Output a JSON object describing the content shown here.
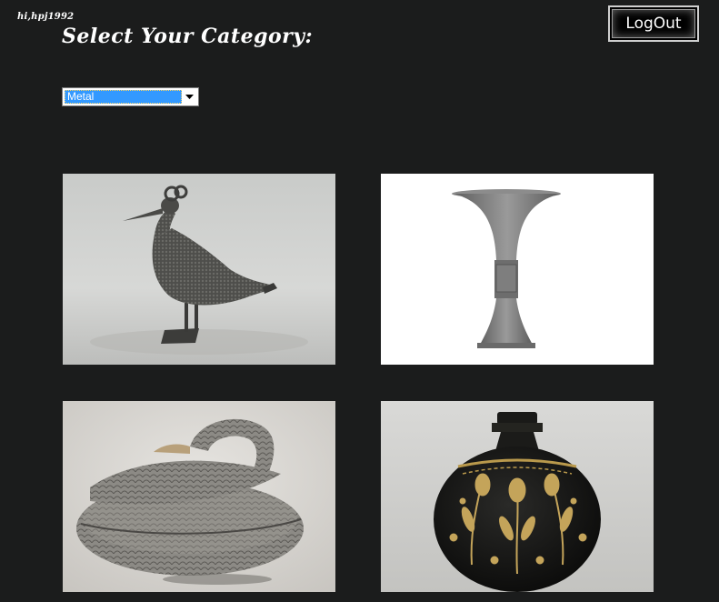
{
  "header": {
    "greeting": "hi,hpj1992",
    "title": "Select Your Category:",
    "logout_label": "LogOut"
  },
  "category_select": {
    "selected": "Metal"
  },
  "gallery": {
    "items": [
      {
        "name": "bird-figure-image"
      },
      {
        "name": "vase-image"
      },
      {
        "name": "duck-box-image"
      },
      {
        "name": "pot-image"
      }
    ]
  },
  "colors": {
    "background": "#1b1c1c",
    "text": "#ffffff",
    "select_highlight": "#3399ff"
  }
}
